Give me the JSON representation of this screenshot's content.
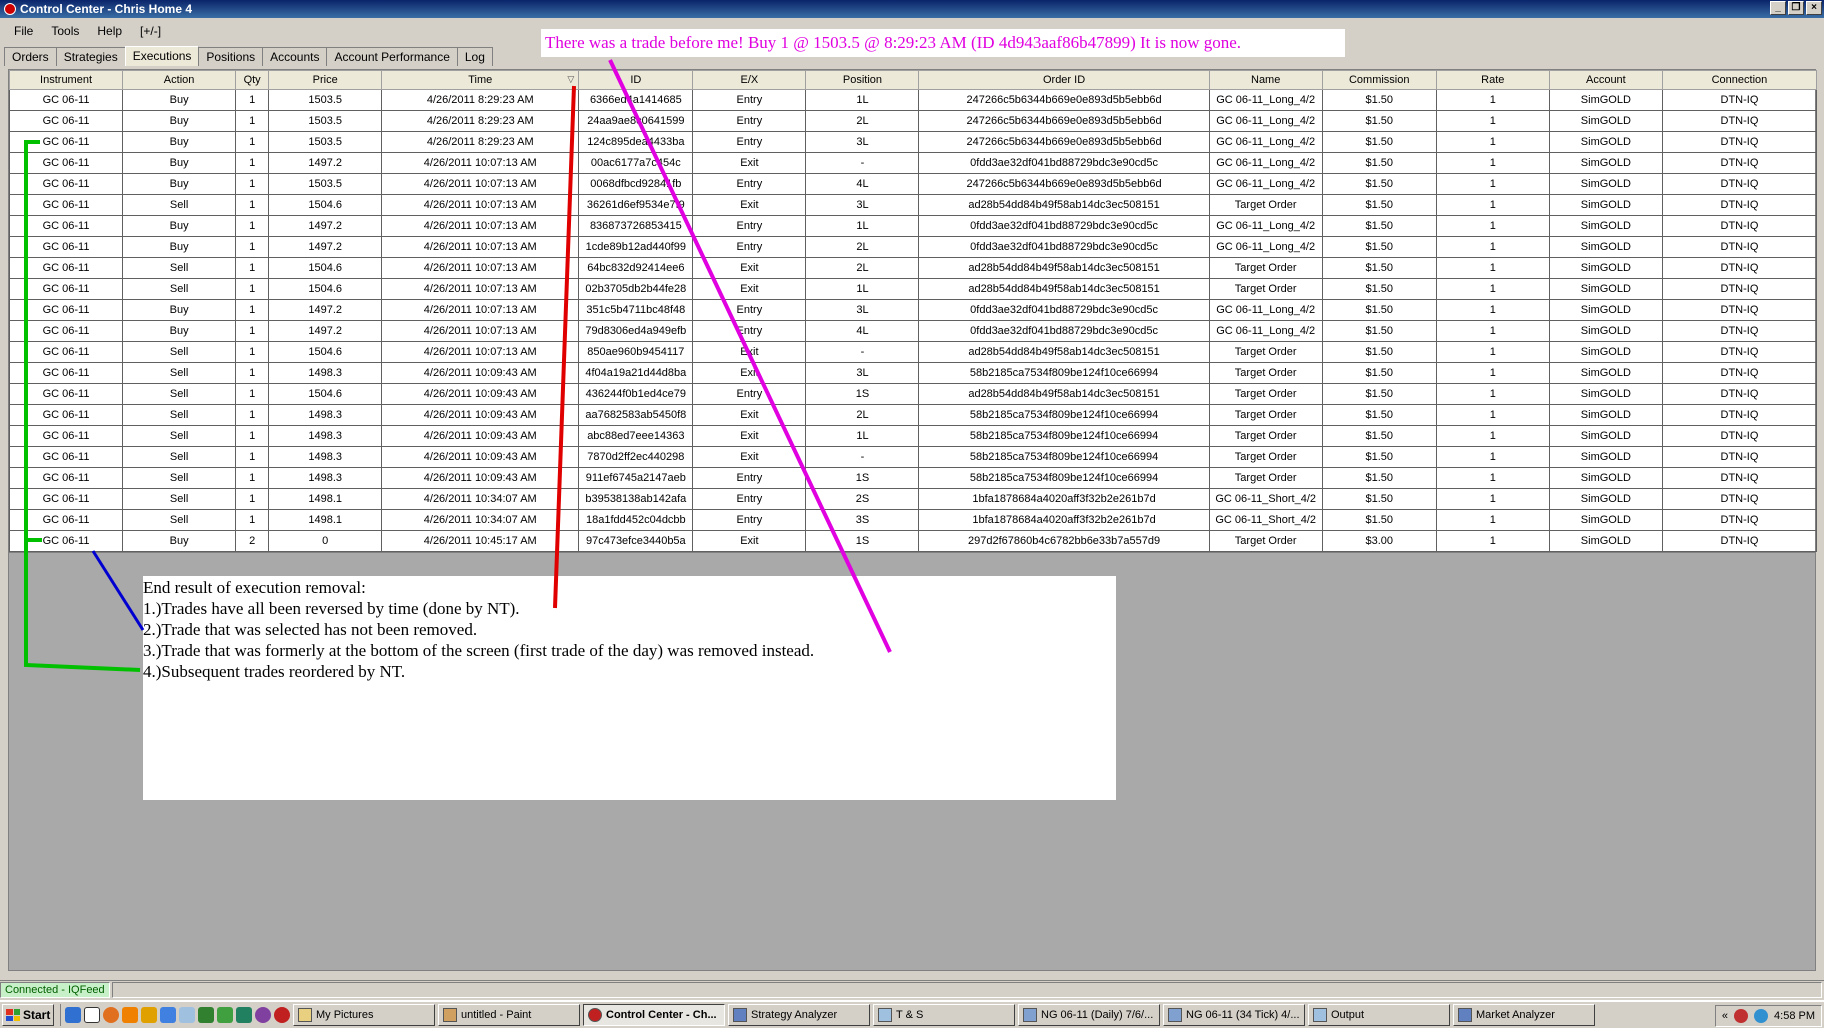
{
  "window": {
    "title": "Control Center - Chris Home 4"
  },
  "menu": [
    "File",
    "Tools",
    "Help",
    "[+/-]"
  ],
  "tabs": [
    "Orders",
    "Strategies",
    "Executions",
    "Positions",
    "Accounts",
    "Account Performance",
    "Log"
  ],
  "active_tab": "Executions",
  "columns": [
    "Instrument",
    "Action",
    "Qty",
    "Price",
    "Time",
    "ID",
    "E/X",
    "Position",
    "Order ID",
    "Name",
    "Commission",
    "Rate",
    "Account",
    "Connection"
  ],
  "rows": [
    [
      "GC 06-11",
      "Buy",
      "1",
      "1503.5",
      "4/26/2011 8:29:23 AM",
      "6366ed4a1414685",
      "Entry",
      "1L",
      "247266c5b6344b669e0e893d5b5ebb6d",
      "GC 06-11_Long_4/2",
      "$1.50",
      "1",
      "SimGOLD",
      "DTN-IQ"
    ],
    [
      "GC 06-11",
      "Buy",
      "1",
      "1503.5",
      "4/26/2011 8:29:23 AM",
      "24aa9ae8c0641599",
      "Entry",
      "2L",
      "247266c5b6344b669e0e893d5b5ebb6d",
      "GC 06-11_Long_4/2",
      "$1.50",
      "1",
      "SimGOLD",
      "DTN-IQ"
    ],
    [
      "GC 06-11",
      "Buy",
      "1",
      "1503.5",
      "4/26/2011 8:29:23 AM",
      "124c895dea4433ba",
      "Entry",
      "3L",
      "247266c5b6344b669e0e893d5b5ebb6d",
      "GC 06-11_Long_4/2",
      "$1.50",
      "1",
      "SimGOLD",
      "DTN-IQ"
    ],
    [
      "GC 06-11",
      "Buy",
      "1",
      "1497.2",
      "4/26/2011 10:07:13 AM",
      "00ac6177a7c454c",
      "Exit",
      "-",
      "0fdd3ae32df041bd88729bdc3e90cd5c",
      "GC 06-11_Long_4/2",
      "$1.50",
      "1",
      "SimGOLD",
      "DTN-IQ"
    ],
    [
      "GC 06-11",
      "Buy",
      "1",
      "1503.5",
      "4/26/2011 10:07:13 AM",
      "0068dfbcd92841fb",
      "Entry",
      "4L",
      "247266c5b6344b669e0e893d5b5ebb6d",
      "GC 06-11_Long_4/2",
      "$1.50",
      "1",
      "SimGOLD",
      "DTN-IQ"
    ],
    [
      "GC 06-11",
      "Sell",
      "1",
      "1504.6",
      "4/26/2011 10:07:13 AM",
      "36261d6ef9534e7f9",
      "Exit",
      "3L",
      "ad28b54dd84b49f58ab14dc3ec508151",
      "Target Order",
      "$1.50",
      "1",
      "SimGOLD",
      "DTN-IQ"
    ],
    [
      "GC 06-11",
      "Buy",
      "1",
      "1497.2",
      "4/26/2011 10:07:13 AM",
      "836873726853415",
      "Entry",
      "1L",
      "0fdd3ae32df041bd88729bdc3e90cd5c",
      "GC 06-11_Long_4/2",
      "$1.50",
      "1",
      "SimGOLD",
      "DTN-IQ"
    ],
    [
      "GC 06-11",
      "Buy",
      "1",
      "1497.2",
      "4/26/2011 10:07:13 AM",
      "1cde89b12ad440f99",
      "Entry",
      "2L",
      "0fdd3ae32df041bd88729bdc3e90cd5c",
      "GC 06-11_Long_4/2",
      "$1.50",
      "1",
      "SimGOLD",
      "DTN-IQ"
    ],
    [
      "GC 06-11",
      "Sell",
      "1",
      "1504.6",
      "4/26/2011 10:07:13 AM",
      "64bc832d92414ee6",
      "Exit",
      "2L",
      "ad28b54dd84b49f58ab14dc3ec508151",
      "Target Order",
      "$1.50",
      "1",
      "SimGOLD",
      "DTN-IQ"
    ],
    [
      "GC 06-11",
      "Sell",
      "1",
      "1504.6",
      "4/26/2011 10:07:13 AM",
      "02b3705db2b44fe28",
      "Exit",
      "1L",
      "ad28b54dd84b49f58ab14dc3ec508151",
      "Target Order",
      "$1.50",
      "1",
      "SimGOLD",
      "DTN-IQ"
    ],
    [
      "GC 06-11",
      "Buy",
      "1",
      "1497.2",
      "4/26/2011 10:07:13 AM",
      "351c5b4711bc48f48",
      "Entry",
      "3L",
      "0fdd3ae32df041bd88729bdc3e90cd5c",
      "GC 06-11_Long_4/2",
      "$1.50",
      "1",
      "SimGOLD",
      "DTN-IQ"
    ],
    [
      "GC 06-11",
      "Buy",
      "1",
      "1497.2",
      "4/26/2011 10:07:13 AM",
      "79d8306ed4a949efb",
      "Entry",
      "4L",
      "0fdd3ae32df041bd88729bdc3e90cd5c",
      "GC 06-11_Long_4/2",
      "$1.50",
      "1",
      "SimGOLD",
      "DTN-IQ"
    ],
    [
      "GC 06-11",
      "Sell",
      "1",
      "1504.6",
      "4/26/2011 10:07:13 AM",
      "850ae960b9454117",
      "Exit",
      "-",
      "ad28b54dd84b49f58ab14dc3ec508151",
      "Target Order",
      "$1.50",
      "1",
      "SimGOLD",
      "DTN-IQ"
    ],
    [
      "GC 06-11",
      "Sell",
      "1",
      "1498.3",
      "4/26/2011 10:09:43 AM",
      "4f04a19a21d44d8ba",
      "Exit",
      "3L",
      "58b2185ca7534f809be124f10ce66994",
      "Target Order",
      "$1.50",
      "1",
      "SimGOLD",
      "DTN-IQ"
    ],
    [
      "GC 06-11",
      "Sell",
      "1",
      "1504.6",
      "4/26/2011 10:09:43 AM",
      "436244f0b1ed4ce79",
      "Entry",
      "1S",
      "ad28b54dd84b49f58ab14dc3ec508151",
      "Target Order",
      "$1.50",
      "1",
      "SimGOLD",
      "DTN-IQ"
    ],
    [
      "GC 06-11",
      "Sell",
      "1",
      "1498.3",
      "4/26/2011 10:09:43 AM",
      "aa7682583ab5450f8",
      "Exit",
      "2L",
      "58b2185ca7534f809be124f10ce66994",
      "Target Order",
      "$1.50",
      "1",
      "SimGOLD",
      "DTN-IQ"
    ],
    [
      "GC 06-11",
      "Sell",
      "1",
      "1498.3",
      "4/26/2011 10:09:43 AM",
      "abc88ed7eee14363",
      "Exit",
      "1L",
      "58b2185ca7534f809be124f10ce66994",
      "Target Order",
      "$1.50",
      "1",
      "SimGOLD",
      "DTN-IQ"
    ],
    [
      "GC 06-11",
      "Sell",
      "1",
      "1498.3",
      "4/26/2011 10:09:43 AM",
      "7870d2ff2ec440298",
      "Exit",
      "-",
      "58b2185ca7534f809be124f10ce66994",
      "Target Order",
      "$1.50",
      "1",
      "SimGOLD",
      "DTN-IQ"
    ],
    [
      "GC 06-11",
      "Sell",
      "1",
      "1498.3",
      "4/26/2011 10:09:43 AM",
      "911ef6745a2147aeb",
      "Entry",
      "1S",
      "58b2185ca7534f809be124f10ce66994",
      "Target Order",
      "$1.50",
      "1",
      "SimGOLD",
      "DTN-IQ"
    ],
    [
      "GC 06-11",
      "Sell",
      "1",
      "1498.1",
      "4/26/2011 10:34:07 AM",
      "b39538138ab142afa",
      "Entry",
      "2S",
      "1bfa1878684a4020aff3f32b2e261b7d",
      "GC 06-11_Short_4/2",
      "$1.50",
      "1",
      "SimGOLD",
      "DTN-IQ"
    ],
    [
      "GC 06-11",
      "Sell",
      "1",
      "1498.1",
      "4/26/2011 10:34:07 AM",
      "18a1fdd452c04dcbb",
      "Entry",
      "3S",
      "1bfa1878684a4020aff3f32b2e261b7d",
      "GC 06-11_Short_4/2",
      "$1.50",
      "1",
      "SimGOLD",
      "DTN-IQ"
    ],
    [
      "GC 06-11",
      "Buy",
      "2",
      "0",
      "4/26/2011 10:45:17 AM",
      "97c473efce3440b5a",
      "Exit",
      "1S",
      "297d2f67860b4c6782bb6e33b7a557d9",
      "Target Order",
      "$3.00",
      "1",
      "SimGOLD",
      "DTN-IQ"
    ]
  ],
  "annotations": {
    "top_note": "There was a trade before me!  Buy 1 @ 1503.5 @ 8:29:23 AM (ID 4d943aaf86b47899)  It is now gone.",
    "box_lines": [
      "End result of execution removal:",
      "1.)Trades have all been reversed by time (done by NT).",
      "2.)Trade that was selected has not been removed.",
      "3.)Trade that was formerly at the bottom of the screen (first trade of the day) was removed instead.",
      "4.)Subsequent trades reordered by NT."
    ],
    "colors": {
      "magenta": "#e000e0",
      "red": "#e00000",
      "blue": "#0000d0",
      "green": "#00c000"
    }
  },
  "status": {
    "connection": "Connected - IQFeed"
  },
  "taskbar": {
    "start": "Start",
    "buttons": [
      "My Pictures",
      "untitled - Paint",
      "Control Center - Ch...",
      "Strategy Analyzer",
      "T & S",
      "NG 06-11 (Daily)  7/6/...",
      "NG 06-11 (34 Tick)  4/...",
      "Output",
      "Market Analyzer"
    ],
    "active_button": "Control Center - Ch...",
    "clock": "4:58 PM",
    "tray_chevron": "«"
  }
}
